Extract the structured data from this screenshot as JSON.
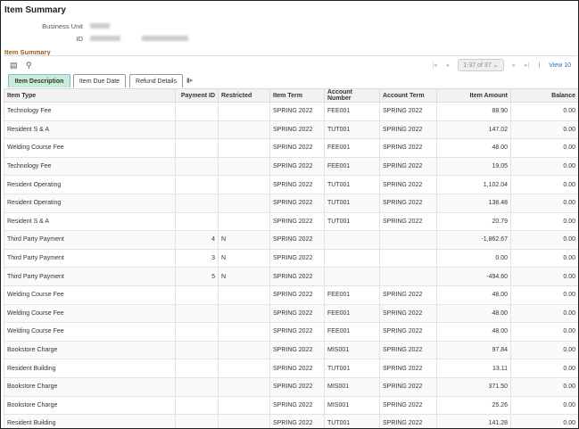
{
  "page": {
    "title": "Item Summary",
    "business_unit_label": "Business Unit",
    "id_label": "ID",
    "section_title": "Item Summary"
  },
  "toolbar": {
    "icons": [
      "grid-settings-icon",
      "search-icon"
    ]
  },
  "pager": {
    "range": "1-37 of 37",
    "view_label": "View 10"
  },
  "tabs": [
    {
      "label": "Item Description",
      "active": true
    },
    {
      "label": "Item Due Date"
    },
    {
      "label": "Refund Details"
    }
  ],
  "columns": [
    "Item Type",
    "Payment ID",
    "Restricted",
    "Item Term",
    "Account Number",
    "Account Term",
    "Item Amount",
    "Balance"
  ],
  "rows": [
    [
      "Technology Fee",
      "",
      "",
      "SPRING 2022",
      "FEE001",
      "SPRING 2022",
      "88.90",
      "0.00"
    ],
    [
      "Resident S & A",
      "",
      "",
      "SPRING 2022",
      "TUT001",
      "SPRING 2022",
      "147.02",
      "0.00"
    ],
    [
      "Welding Course Fee",
      "",
      "",
      "SPRING 2022",
      "FEE001",
      "SPRING 2022",
      "48.00",
      "0.00"
    ],
    [
      "Technology Fee",
      "",
      "",
      "SPRING 2022",
      "FEE001",
      "SPRING 2022",
      "19.05",
      "0.00"
    ],
    [
      "Resident Operating",
      "",
      "",
      "SPRING 2022",
      "TUT001",
      "SPRING 2022",
      "1,102.04",
      "0.00"
    ],
    [
      "Resident Operating",
      "",
      "",
      "SPRING 2022",
      "TUT001",
      "SPRING 2022",
      "138.48",
      "0.00"
    ],
    [
      "Resident S & A",
      "",
      "",
      "SPRING 2022",
      "TUT001",
      "SPRING 2022",
      "20.79",
      "0.00"
    ],
    [
      "Third Party Payment",
      "4",
      "N",
      "SPRING 2022",
      "",
      "",
      "-1,862.67",
      "0.00"
    ],
    [
      "Third Party Payment",
      "3",
      "N",
      "SPRING 2022",
      "",
      "",
      "0.00",
      "0.00"
    ],
    [
      "Third Party Payment",
      "5",
      "N",
      "SPRING 2022",
      "",
      "",
      "-494.60",
      "0.00"
    ],
    [
      "Welding Course Fee",
      "",
      "",
      "SPRING 2022",
      "FEE001",
      "SPRING 2022",
      "48.00",
      "0.00"
    ],
    [
      "Welding Course Fee",
      "",
      "",
      "SPRING 2022",
      "FEE001",
      "SPRING 2022",
      "48.00",
      "0.00"
    ],
    [
      "Welding Course Fee",
      "",
      "",
      "SPRING 2022",
      "FEE001",
      "SPRING 2022",
      "48.00",
      "0.00"
    ],
    [
      "Bookstore Charge",
      "",
      "",
      "SPRING 2022",
      "MIS001",
      "SPRING 2022",
      "97.84",
      "0.00"
    ],
    [
      "Resident Building",
      "",
      "",
      "SPRING 2022",
      "TUT001",
      "SPRING 2022",
      "13.11",
      "0.00"
    ],
    [
      "Bookstore Charge",
      "",
      "",
      "SPRING 2022",
      "MIS001",
      "SPRING 2022",
      "371.50",
      "0.00"
    ],
    [
      "Bookstore Charge",
      "",
      "",
      "SPRING 2022",
      "MIS001",
      "SPRING 2022",
      "25.26",
      "0.00"
    ],
    [
      "Resident Building",
      "",
      "",
      "SPRING 2022",
      "TUT001",
      "SPRING 2022",
      "141.28",
      "0.00"
    ]
  ]
}
